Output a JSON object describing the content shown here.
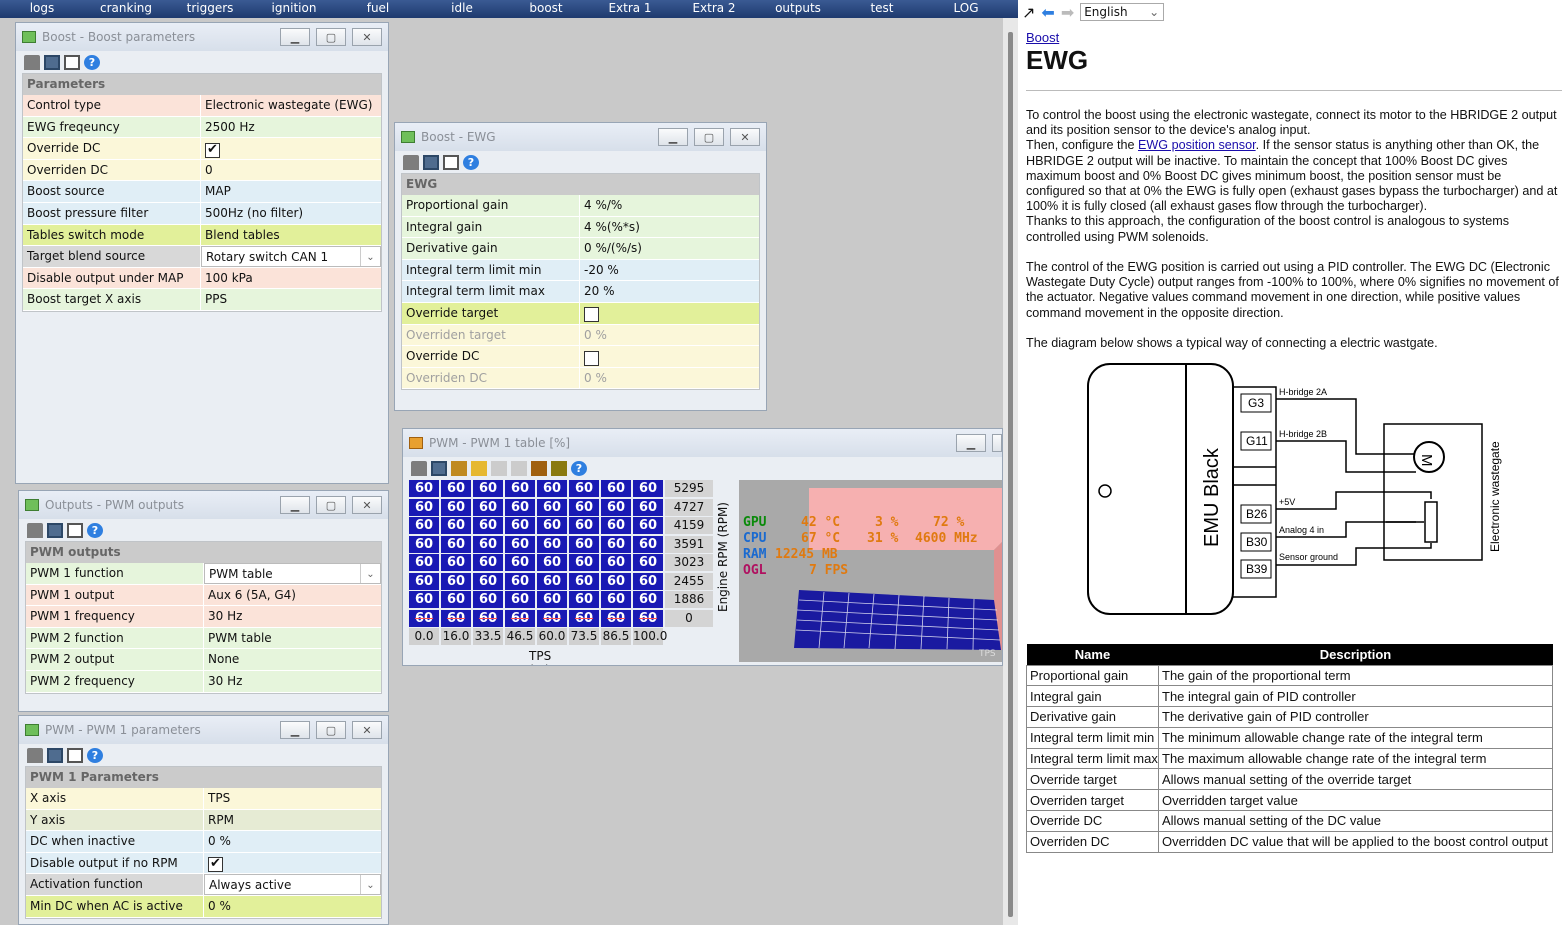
{
  "menu": [
    "logs",
    "cranking",
    "triggers",
    "ignition",
    "fuel",
    "idle",
    "boost",
    "Extra 1",
    "Extra 2",
    "outputs",
    "test",
    "LOG"
  ],
  "boost_params": {
    "title": "Boost - Boost parameters",
    "section": "Parameters",
    "rows": [
      {
        "k": "Control type",
        "v": "Electronic wastegate (EWG)"
      },
      {
        "k": "EWG freqeuncy",
        "v": "2500 Hz"
      },
      {
        "k": "Override DC",
        "v": "✔"
      },
      {
        "k": "Overriden DC",
        "v": "0"
      },
      {
        "k": "Boost source",
        "v": "MAP"
      },
      {
        "k": "Boost pressure filter",
        "v": "500Hz (no filter)"
      },
      {
        "k": "Tables switch mode",
        "v": "Blend tables"
      },
      {
        "k": "Target blend source",
        "v": "Rotary switch CAN 1"
      },
      {
        "k": "Disable output under MAP",
        "v": "100 kPa"
      },
      {
        "k": "Boost target X axis",
        "v": "PPS"
      }
    ]
  },
  "ewg": {
    "title": "Boost - EWG",
    "section": "EWG",
    "rows": [
      {
        "k": "Proportional gain",
        "v": "4 %/%"
      },
      {
        "k": "Integral gain",
        "v": "4 %(%*s)"
      },
      {
        "k": "Derivative gain",
        "v": "0 %/(%/s)"
      },
      {
        "k": "Integral term limit min",
        "v": "-20 %"
      },
      {
        "k": "Integral term limit max",
        "v": "20 %"
      },
      {
        "k": "Override target",
        "v": ""
      },
      {
        "k": "Overriden target",
        "v": "0 %"
      },
      {
        "k": "Override DC",
        "v": ""
      },
      {
        "k": "Overriden DC",
        "v": "0 %"
      }
    ]
  },
  "pwm_outputs": {
    "title": "Outputs - PWM outputs",
    "section": "PWM outputs",
    "rows": [
      {
        "k": "PWM 1 function",
        "v": "PWM table"
      },
      {
        "k": "PWM 1 output",
        "v": "Aux 6 (5A, G4)"
      },
      {
        "k": "PWM 1 frequency",
        "v": "30 Hz"
      },
      {
        "k": "PWM 2 function",
        "v": "PWM table"
      },
      {
        "k": "PWM 2 output",
        "v": "None"
      },
      {
        "k": "PWM 2 frequency",
        "v": "30 Hz"
      }
    ]
  },
  "pwm1_params": {
    "title": "PWM - PWM 1 parameters",
    "section": "PWM 1 Parameters",
    "rows": [
      {
        "k": "X axis",
        "v": "TPS"
      },
      {
        "k": "Y axis",
        "v": "RPM"
      },
      {
        "k": "DC when inactive",
        "v": "0 %"
      },
      {
        "k": "Disable output if no RPM",
        "v": "✔"
      },
      {
        "k": "Activation function",
        "v": "Always active"
      },
      {
        "k": "Min DC when AC is active",
        "v": "0 %"
      }
    ]
  },
  "pwm_table": {
    "title": "PWM - PWM 1 table [%]",
    "cell_value": "60",
    "rpm": [
      "5295",
      "4727",
      "4159",
      "3591",
      "3023",
      "2455",
      "1886",
      "0"
    ],
    "tps": [
      "0.0",
      "16.0",
      "33.5",
      "46.5",
      "60.0",
      "73.5",
      "86.5",
      "100.0"
    ],
    "x_label": "TPS (%)",
    "y_label": "Engine RPM (RPM)",
    "overlay": {
      "gpu": "GPU",
      "cpu": "CPU",
      "ram": "RAM",
      "ogl": "OGL",
      "v1": "42 °C",
      "v2": "3 %",
      "v3": "72 %",
      "v4": "67 °C",
      "v5": "31 %",
      "v6": "4600 MHz",
      "v7": "12245 MB",
      "v8": "7 FPS"
    },
    "axis_3d": "TPS"
  },
  "help": {
    "language": "English",
    "breadcrumb": "Boost",
    "heading": "EWG",
    "p1": "To control the boost using the electronic wastegate, connect its motor to the HBRIDGE 2 output and its position sensor to the device's analog input.",
    "p2a": "Then, configure the ",
    "p2link": "EWG position sensor",
    "p2b": ". If the sensor status is anything other than OK, the HBRIDGE 2 output will be inactive. To maintain the concept that 100% Boost DC gives maximum boost and 0% Boost DC gives minimum boost, the position sensor must be configured so that at 0% the EWG is fully open (exhaust gases bypass the turbocharger) and at 100% it is fully closed (all exhaust gases flow through the turbocharger).",
    "p3": "Thanks to this approach, the configuration of the boost control is analogous to systems controlled using PWM solenoids.",
    "p4": "The control of the EWG position is carried out using a PID controller. The EWG DC (Electronic Wastegate Duty Cycle) output ranges from -100% to 100%, where 0% signifies no movement of the actuator. Negative values command movement in one direction, while positive values command movement in the opposite direction.",
    "p5": "The diagram below shows a typical way of connecting a electric wastgate.",
    "diagram": {
      "device": "EMU Black",
      "pins": [
        "G3",
        "G11",
        "B26",
        "B30",
        "B39"
      ],
      "labels": [
        "H-bridge 2A",
        "H-bridge 2B",
        "+5V",
        "Analog 4 in",
        "Sensor ground"
      ],
      "side": "Electronic wastegate",
      "motor": "M"
    },
    "table_head": [
      "Name",
      "Description"
    ],
    "table_rows": [
      [
        "Proportional gain",
        "The gain of the proportional term"
      ],
      [
        "Integral gain",
        "The integral gain of PID controller"
      ],
      [
        "Derivative gain",
        "The derivative gain of PID controller"
      ],
      [
        "Integral term limit min",
        "The minimum allowable change rate of the integral term"
      ],
      [
        "Integral term limit max",
        "The maximum allowable change rate of the integral term"
      ],
      [
        "Override target",
        "Allows manual setting of the override target"
      ],
      [
        "Overriden target",
        "Overridden target value"
      ],
      [
        "Override DC",
        "Allows manual setting of the DC value"
      ],
      [
        "Overriden DC",
        "Overridden DC value that will be applied to the boost control output"
      ]
    ]
  }
}
